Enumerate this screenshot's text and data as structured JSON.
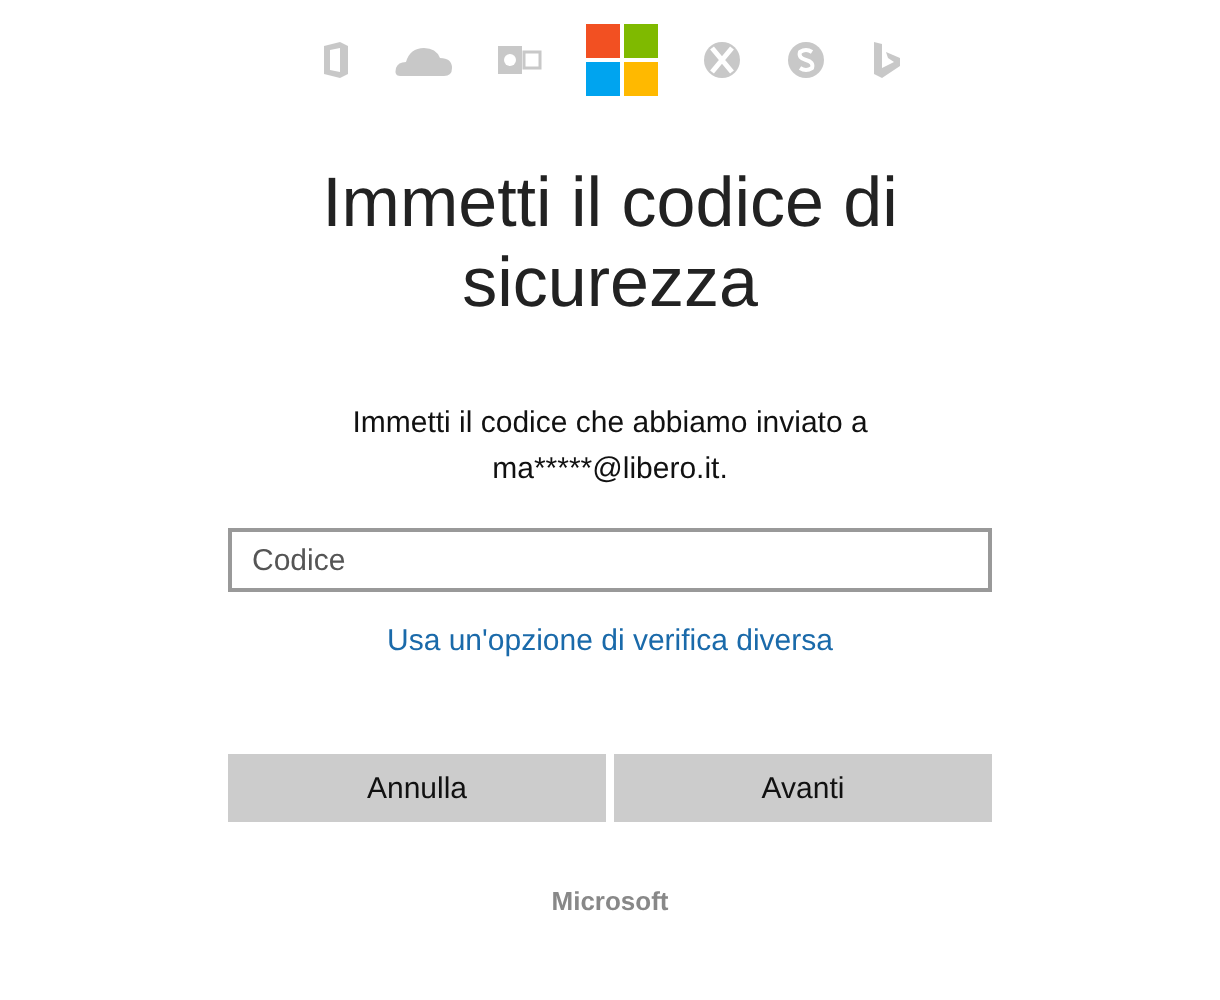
{
  "title": "Immetti il codice di sicurezza",
  "message": "Immetti il codice che abbiamo inviato a ma*****@libero.it.",
  "code_field": {
    "placeholder": "Codice"
  },
  "alternate_link": "Usa un'opzione di verifica diversa",
  "buttons": [
    {
      "label": "Annulla"
    },
    {
      "label": "Avanti"
    }
  ],
  "footer": "Microsoft"
}
